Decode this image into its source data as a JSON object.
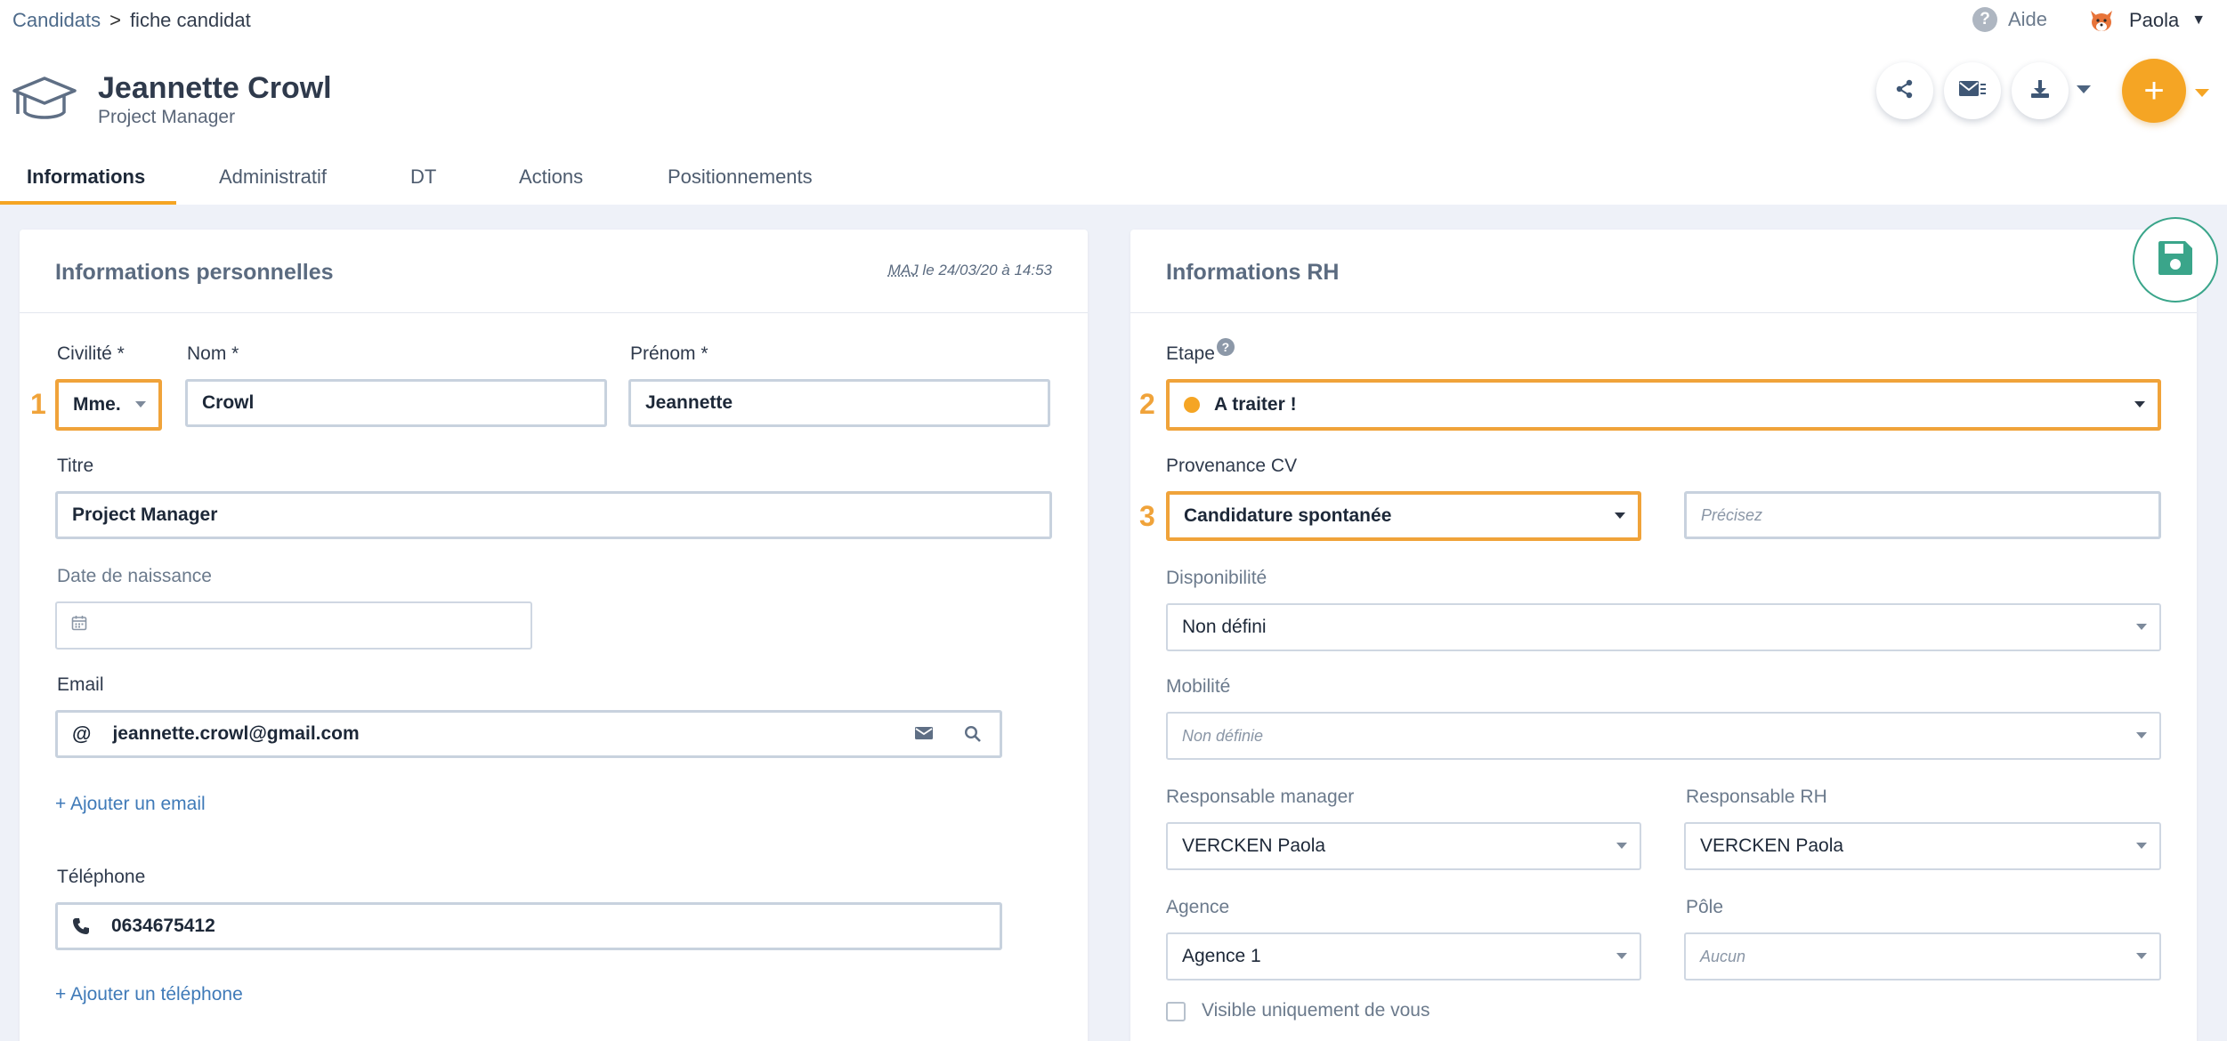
{
  "breadcrumb": {
    "parent": "Candidats",
    "separator": ">",
    "current": "fiche candidat"
  },
  "header": {
    "help_label": "Aide",
    "help_icon": "?",
    "user_name": "Paola",
    "candidate_name": "Jeannette Crowl",
    "candidate_title": "Project Manager",
    "plus_label": "+"
  },
  "tabs": [
    {
      "label": "Informations",
      "active": true
    },
    {
      "label": "Administratif",
      "active": false
    },
    {
      "label": "DT",
      "active": false
    },
    {
      "label": "Actions",
      "active": false
    },
    {
      "label": "Positionnements",
      "active": false
    }
  ],
  "personal": {
    "title": "Informations personnelles",
    "maj_abbr": "MAJ",
    "maj_rest": " le 24/03/20 à 14:53",
    "civilite_label": "Civilité *",
    "civilite_value": "Mme.",
    "nom_label": "Nom *",
    "nom_value": "Crowl",
    "prenom_label": "Prénom *",
    "prenom_value": "Jeannette",
    "titre_label": "Titre",
    "titre_value": "Project Manager",
    "naissance_label": "Date de naissance",
    "email_label": "Email",
    "email_prefix": "@",
    "email_value": "jeannette.crowl@gmail.com",
    "add_email": "+ Ajouter un email",
    "tel_label": "Téléphone",
    "tel_value": "0634675412",
    "add_tel": "+ Ajouter un téléphone",
    "marker_1": "1"
  },
  "rh": {
    "title": "Informations RH",
    "etape_label": "Etape",
    "etape_help": "?",
    "etape_value": "A traiter !",
    "marker_2": "2",
    "provenance_label": "Provenance CV",
    "provenance_value": "Candidature spontanée",
    "precisez_placeholder": "Précisez",
    "marker_3": "3",
    "disponibilite_label": "Disponibilité",
    "disponibilite_value": "Non défini",
    "mobilite_label": "Mobilité",
    "mobilite_value": "Non définie",
    "resp_manager_label": "Responsable manager",
    "resp_manager_value": "VERCKEN Paola",
    "resp_rh_label": "Responsable RH",
    "resp_rh_value": "VERCKEN Paola",
    "agence_label": "Agence",
    "agence_value": "Agence 1",
    "pole_label": "Pôle",
    "pole_value": "Aucun",
    "visible_label": "Visible uniquement de vous"
  },
  "colors": {
    "accent": "#f5a524",
    "highlight": "#f0a33a",
    "save": "#3aa58a",
    "link": "#3f7ab8",
    "background": "#eef1f8"
  }
}
